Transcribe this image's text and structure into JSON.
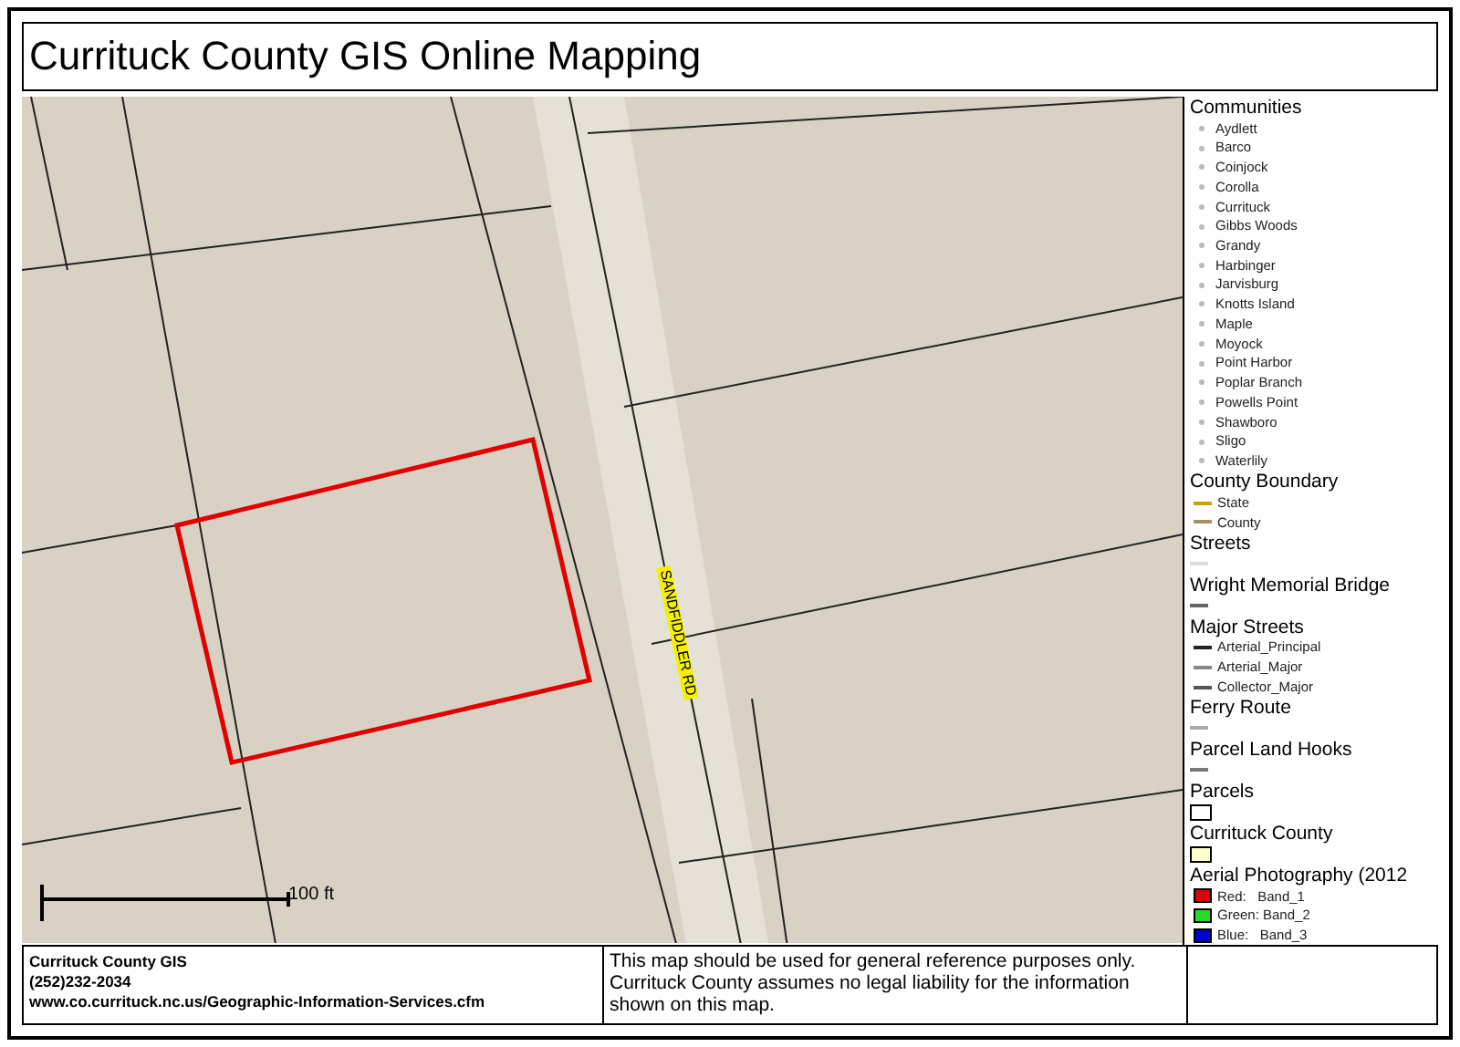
{
  "title": "Currituck County GIS Online Mapping",
  "map": {
    "road_label": "SANDFIDDLER RD",
    "scale_label": "100 ft"
  },
  "legend": [
    {
      "title": "Communities",
      "items": [
        {
          "label": "Aydlett",
          "kind": "dot"
        },
        {
          "label": "Barco",
          "kind": "dot"
        },
        {
          "label": "Coinjock",
          "kind": "dot"
        },
        {
          "label": "Corolla",
          "kind": "dot"
        },
        {
          "label": "Currituck",
          "kind": "dot"
        },
        {
          "label": "Gibbs Woods",
          "kind": "dot"
        },
        {
          "label": "Grandy",
          "kind": "dot"
        },
        {
          "label": "Harbinger",
          "kind": "dot"
        },
        {
          "label": "Jarvisburg",
          "kind": "dot"
        },
        {
          "label": "Knotts Island",
          "kind": "dot"
        },
        {
          "label": "Maple",
          "kind": "dot"
        },
        {
          "label": "Moyock",
          "kind": "dot"
        },
        {
          "label": "Point Harbor",
          "kind": "dot"
        },
        {
          "label": "Poplar Branch",
          "kind": "dot"
        },
        {
          "label": "Powells Point",
          "kind": "dot"
        },
        {
          "label": "Shawboro",
          "kind": "dot"
        },
        {
          "label": "Sligo",
          "kind": "dot"
        },
        {
          "label": "Waterlily",
          "kind": "dot"
        }
      ]
    },
    {
      "title": "County Boundary",
      "items": [
        {
          "label": "State",
          "kind": "line",
          "color": "#c8a400"
        },
        {
          "label": "County",
          "kind": "line",
          "color": "#a89060"
        }
      ]
    },
    {
      "title": "Streets",
      "symbol": {
        "kind": "line",
        "color": "#dddddd"
      }
    },
    {
      "title": "Wright Memorial Bridge",
      "symbol": {
        "kind": "line",
        "color": "#666666"
      }
    },
    {
      "title": "Major Streets",
      "items": [
        {
          "label": "Arterial_Principal",
          "kind": "line",
          "color": "#222222"
        },
        {
          "label": "Arterial_Major",
          "kind": "line",
          "color": "#888888"
        },
        {
          "label": "Collector_Major",
          "kind": "line",
          "color": "#555555"
        }
      ]
    },
    {
      "title": "Ferry Route",
      "symbol": {
        "kind": "line",
        "color": "#aaaaaa"
      }
    },
    {
      "title": "Parcel Land Hooks",
      "symbol": {
        "kind": "line",
        "color": "#777777"
      }
    },
    {
      "title": "Parcels",
      "symbol": {
        "kind": "box",
        "color": "#ffffff"
      }
    },
    {
      "title": "Currituck County",
      "symbol": {
        "kind": "box",
        "color": "#ffffcc"
      }
    },
    {
      "title": "Aerial Photography (2012",
      "items": [
        {
          "label": "Red:   Band_1",
          "kind": "box",
          "color": "#e00000"
        },
        {
          "label": "Green: Band_2",
          "kind": "box",
          "color": "#22dd22"
        },
        {
          "label": "Blue:   Band_3",
          "kind": "box",
          "color": "#0000cc"
        }
      ]
    }
  ],
  "footer": {
    "contact": [
      "Currituck County GIS",
      "(252)232-2034",
      "www.co.currituck.nc.us/Geographic-Information-Services.cfm"
    ],
    "disclaimer": "This map should be used for general reference purposes only. Currituck County assumes no legal liability for the information shown on this map."
  }
}
